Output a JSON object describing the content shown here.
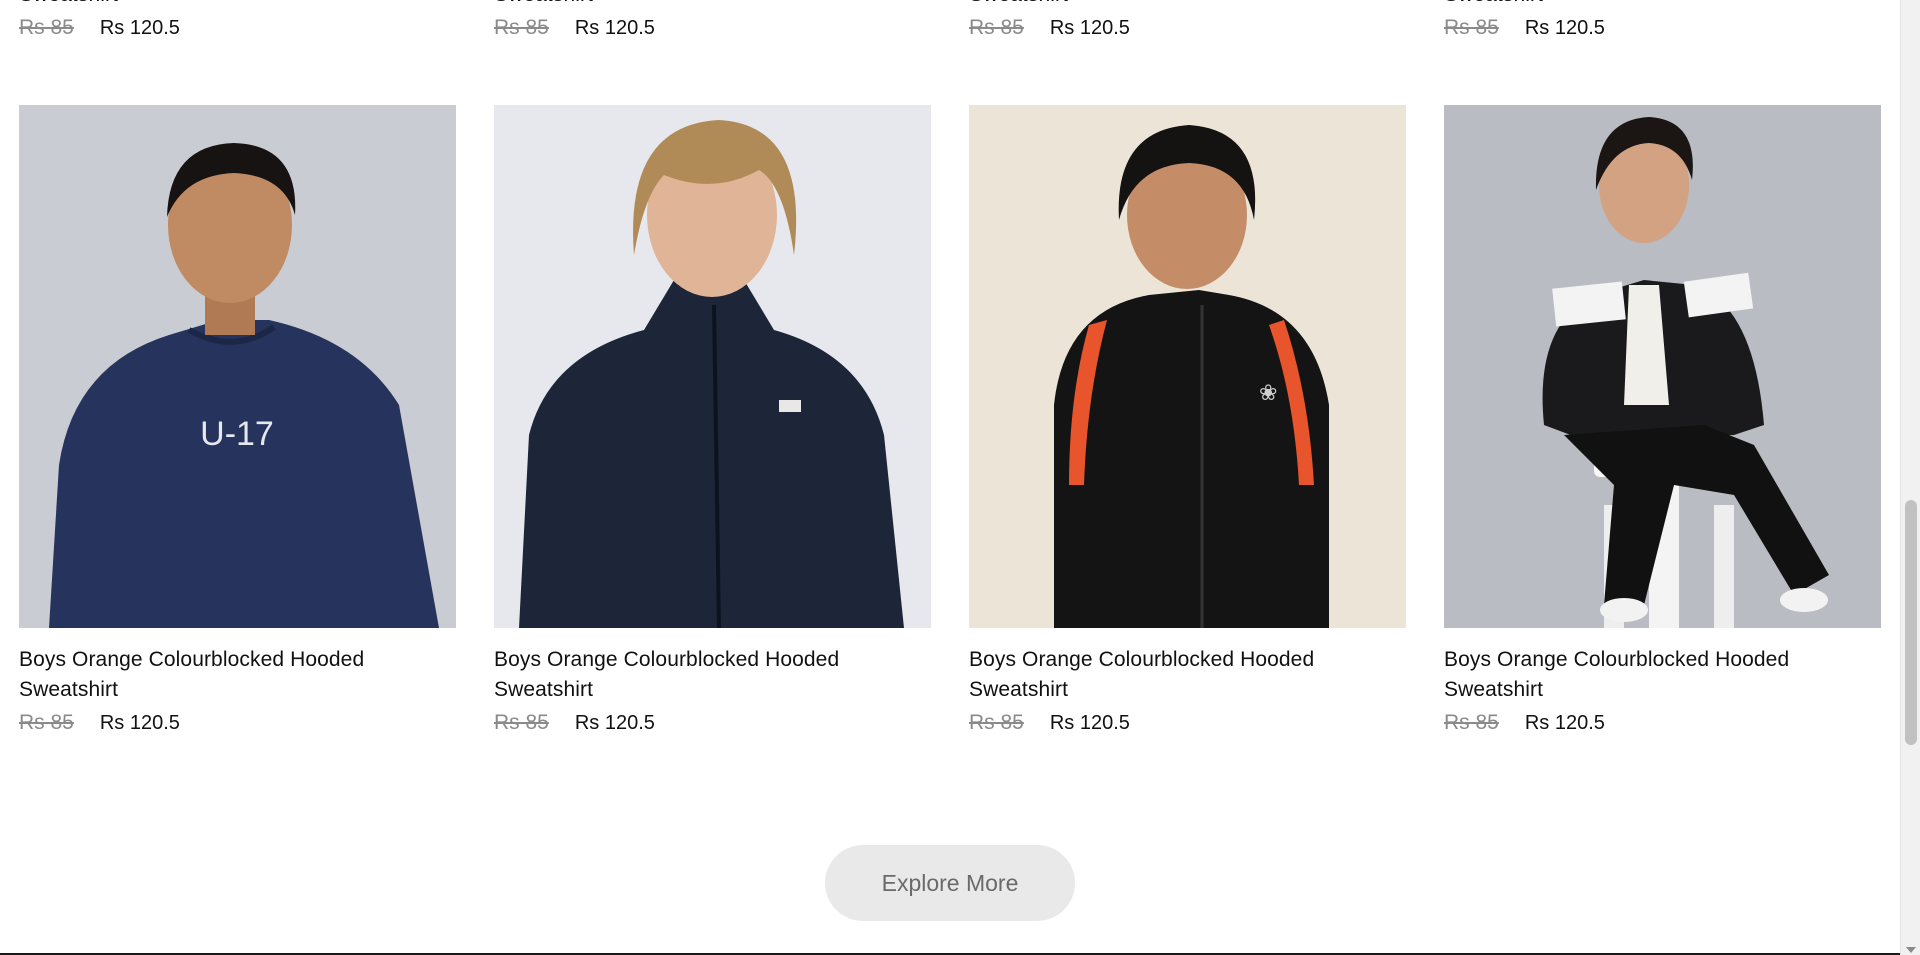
{
  "top_row": [
    {
      "name_tail": "Sweatshirt",
      "old_price": "Rs 85",
      "price": "Rs 120.5"
    },
    {
      "name_tail": "Sweatshirt",
      "old_price": "Rs 85",
      "price": "Rs 120.5"
    },
    {
      "name_tail": "Sweatshirt",
      "old_price": "Rs 85",
      "price": "Rs 120.5"
    },
    {
      "name_tail": "Sweatshirt",
      "old_price": "Rs 85",
      "price": "Rs 120.5"
    }
  ],
  "products": [
    {
      "name": "Boys Orange Colourblocked Hooded Sweatshirt",
      "old_price": "Rs 85",
      "price": "Rs 120.5",
      "image": "boy-navy-sweatshirt",
      "bg": "#c9ccd3",
      "garment": "#26335c"
    },
    {
      "name": "Boys Orange Colourblocked Hooded Sweatshirt",
      "old_price": "Rs 85",
      "price": "Rs 120.5",
      "image": "boy-navy-jacket",
      "bg": "#e6e8ed",
      "garment": "#1d2538"
    },
    {
      "name": "Boys Orange Colourblocked Hooded Sweatshirt",
      "old_price": "Rs 85",
      "price": "Rs 120.5",
      "image": "boy-black-track-jacket",
      "bg": "#ede4d8",
      "garment": "#141414",
      "accent": "#e8542b"
    },
    {
      "name": "Boys Orange Colourblocked Hooded Sweatshirt",
      "old_price": "Rs 85",
      "price": "Rs 120.5",
      "image": "boy-black-bomber-jacket",
      "bg": "#b9bcc2",
      "garment": "#1a1a1c"
    }
  ],
  "explore_label": "Explore More"
}
